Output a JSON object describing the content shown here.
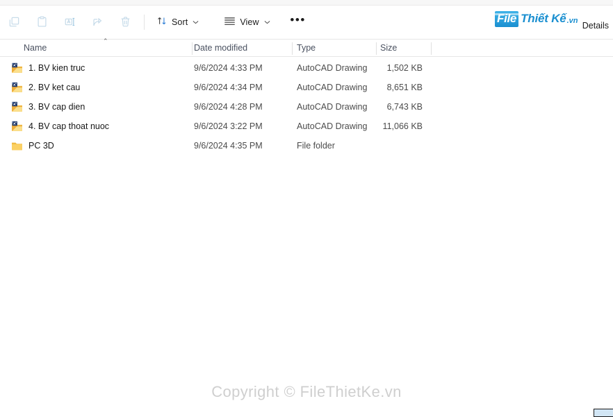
{
  "window": {
    "view_mode_label": "Details"
  },
  "toolbar": {
    "icon_buttons": [
      {
        "name": "copy-icon",
        "label": "Copy"
      },
      {
        "name": "paste-icon",
        "label": "Paste"
      },
      {
        "name": "rename-icon",
        "label": "Rename"
      },
      {
        "name": "share-icon",
        "label": "Share"
      },
      {
        "name": "delete-icon",
        "label": "Delete"
      }
    ],
    "sort_label": "Sort",
    "view_label": "View",
    "more_label": "•••",
    "chevron": "⌄"
  },
  "columns": {
    "name": "Name",
    "date_modified": "Date modified",
    "type": "Type",
    "size": "Size",
    "sort_arrow": "⌃"
  },
  "files": [
    {
      "name": "1. BV kien truc",
      "date": "9/6/2024 4:33 PM",
      "type": "AutoCAD Drawing",
      "size": "1,502 KB",
      "icon": "autocad-drawing-icon"
    },
    {
      "name": "2. BV ket cau",
      "date": "9/6/2024 4:34 PM",
      "type": "AutoCAD Drawing",
      "size": "8,651 KB",
      "icon": "autocad-drawing-icon"
    },
    {
      "name": "3. BV cap dien",
      "date": "9/6/2024 4:28 PM",
      "type": "AutoCAD Drawing",
      "size": "6,743 KB",
      "icon": "autocad-drawing-icon"
    },
    {
      "name": "4. BV cap thoat nuoc",
      "date": "9/6/2024 3:22 PM",
      "type": "AutoCAD Drawing",
      "size": "11,066 KB",
      "icon": "autocad-drawing-icon"
    },
    {
      "name": "PC 3D",
      "date": "9/6/2024 4:35 PM",
      "type": "File folder",
      "size": "",
      "icon": "folder-icon"
    }
  ],
  "watermarks": {
    "logo_file": "File",
    "logo_rest": "Thiết Kế",
    "logo_tld": ".vn",
    "center": "Copyright © FileThietKe.vn"
  },
  "colors": {
    "accent_blue": "#1a8fd0",
    "folder_yellow": "#f2c14a",
    "header_text": "#4a5160",
    "watermark_gray": "#cfcfcf"
  }
}
